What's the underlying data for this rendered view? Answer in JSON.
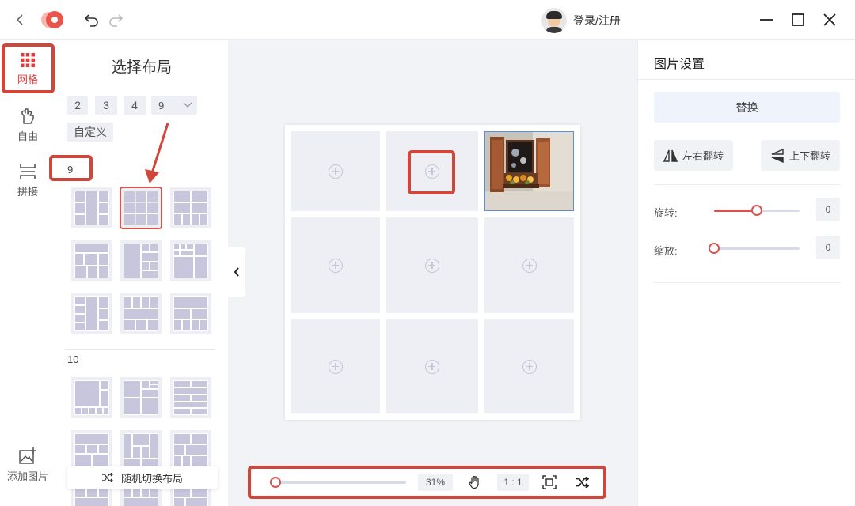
{
  "titlebar": {
    "user_label": "登录/注册"
  },
  "rail": {
    "items": [
      {
        "label": "网格",
        "icon": "grid-icon",
        "active": true
      },
      {
        "label": "自由",
        "icon": "free-icon",
        "active": false
      },
      {
        "label": "拼接",
        "icon": "splice-icon",
        "active": false
      }
    ],
    "add_image_label": "添加图片"
  },
  "layout_panel": {
    "title": "选择布局",
    "count_chips": [
      "2",
      "3",
      "4"
    ],
    "count_select": "9",
    "custom_label": "自定义",
    "section_9": "9",
    "section_10": "10",
    "random_label": "随机切换布局"
  },
  "bottom_bar": {
    "zoom_label": "31%",
    "ratio_label": "1 : 1",
    "zoom_fraction": 0.0
  },
  "settings": {
    "title": "图片设置",
    "replace_label": "替换",
    "flip_h_label": "左右翻转",
    "flip_v_label": "上下翻转",
    "rotate_label": "旋转:",
    "rotate_value": "0",
    "scale_label": "缩放:",
    "scale_value": "0"
  },
  "colors": {
    "accent": "#d9534f",
    "annotation": "#d0463a",
    "cell": "#eeeff5",
    "workspace": "#f2f3f7"
  }
}
